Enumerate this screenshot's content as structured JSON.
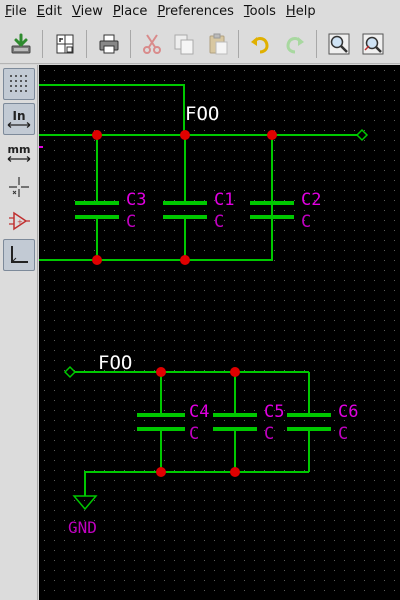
{
  "menu": {
    "file": {
      "mnemonic": "F",
      "rest": "ile"
    },
    "edit": {
      "mnemonic": "E",
      "rest": "dit"
    },
    "view": {
      "mnemonic": "V",
      "rest": "iew"
    },
    "place": {
      "mnemonic": "P",
      "rest": "lace"
    },
    "preferences": {
      "mnemonic": "P",
      "rest": "references"
    },
    "tools": {
      "mnemonic": "T",
      "rest": "ools"
    },
    "help": {
      "mnemonic": "H",
      "rest": "elp"
    }
  },
  "toolbar": {
    "icons": [
      "save-icon",
      "page-settings-icon",
      "print-icon",
      "cut-icon",
      "copy-icon",
      "paste-icon",
      "undo-icon",
      "redo-icon",
      "zoom-in-icon",
      "zoom-fit-icon"
    ]
  },
  "left_toolbar": {
    "in_label": "In",
    "mm_label": "mm"
  },
  "schematic": {
    "net_label_top": "FOO",
    "net_label_bottom": "FOO",
    "gnd_label": "GND",
    "components": [
      {
        "ref": "C3",
        "value": "C"
      },
      {
        "ref": "C1",
        "value": "C"
      },
      {
        "ref": "C2",
        "value": "C"
      },
      {
        "ref": "C4",
        "value": "C"
      },
      {
        "ref": "C5",
        "value": "C"
      },
      {
        "ref": "C6",
        "value": "C"
      }
    ]
  },
  "colors": {
    "background": "#000000",
    "wire": "#00c800",
    "junction": "#e00000",
    "component_body": "#00c800",
    "reference": "#e000e0",
    "value": "#c000c0",
    "net_label": "#ffffff",
    "grid_dot": "#5a5a5a"
  }
}
